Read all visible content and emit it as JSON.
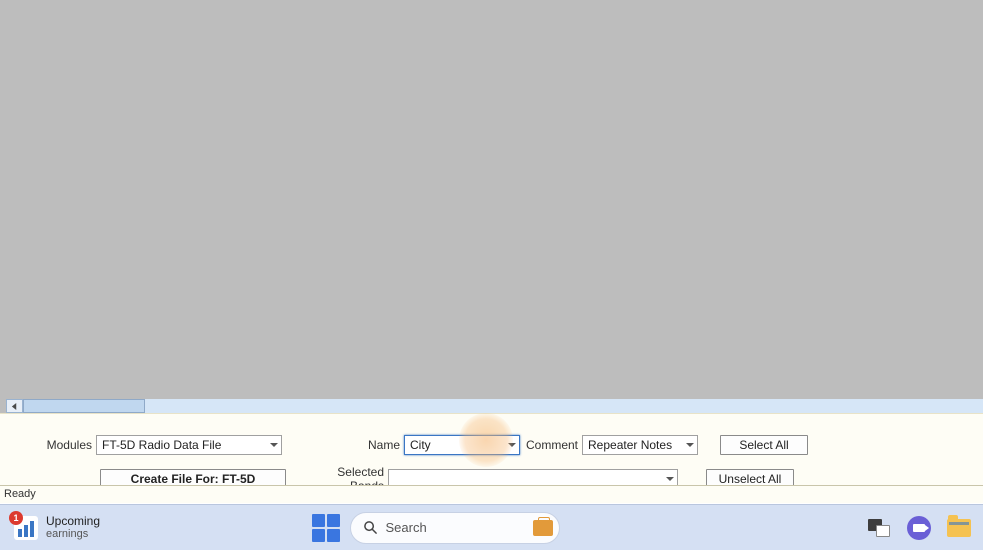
{
  "controls": {
    "modules_label": "Modules",
    "modules_value": "FT-5D Radio Data File",
    "create_button": "Create File For: FT-5D",
    "name_label": "Name",
    "name_value": "City",
    "comment_label": "Comment",
    "comment_value": "Repeater Notes",
    "selected_bands_label": "Selected Bands",
    "selected_bands_value": "",
    "select_all": "Select All",
    "unselect_all": "Unselect All"
  },
  "status_bar": {
    "text": "Ready"
  },
  "taskbar": {
    "notification": {
      "badge": "1",
      "title": "Upcoming",
      "subtitle": "earnings"
    },
    "search_placeholder": "Search"
  }
}
